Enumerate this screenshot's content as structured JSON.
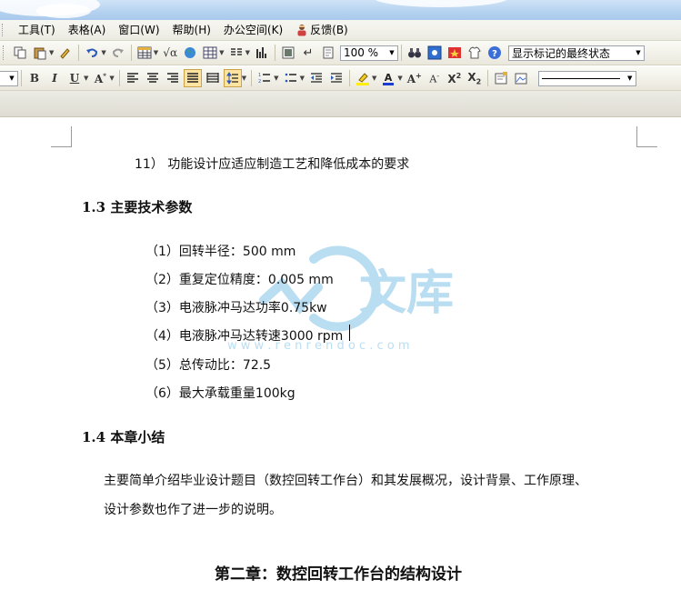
{
  "menu": {
    "tools": "工具(T)",
    "table": "表格(A)",
    "window": "窗口(W)",
    "help": "帮助(H)",
    "office_space": "办公空间(K)",
    "feedback": "反馈(B)"
  },
  "toolbar": {
    "zoom": "100 %",
    "markup_state": "显示标记的最终状态"
  },
  "document": {
    "item11": "11）  功能设计应适应制造工艺和降低成本的要求",
    "h13": "1.3   主要技术参数",
    "p1": "（1）回转半径：500 mm",
    "p2": "（2）重复定位精度：0.005 mm",
    "p3": "（3）电液脉冲马达功率0.75kw",
    "p4": "（4）电液脉冲马达转速3000 rpm",
    "p5": "（5）总传动比：72.5",
    "p6": "（6）最大承载重量100kg",
    "h14": "1.4   本章小结",
    "summary1": "主要简单介绍毕业设计题目（数控回转工作台）和其发展概况，设计背景、工作原理、",
    "summary2": "设计参数也作了进一步的说明。",
    "chapter2": "第二章：数控回转工作台的结构设计"
  },
  "watermark": {
    "text": "文库",
    "url": "w w w . r e n r e n d o c . c o m"
  },
  "colors": {
    "accent_blue": "#3a6fd8",
    "watermark": "#2f9bd6",
    "highlight": "#ffe3a0"
  }
}
